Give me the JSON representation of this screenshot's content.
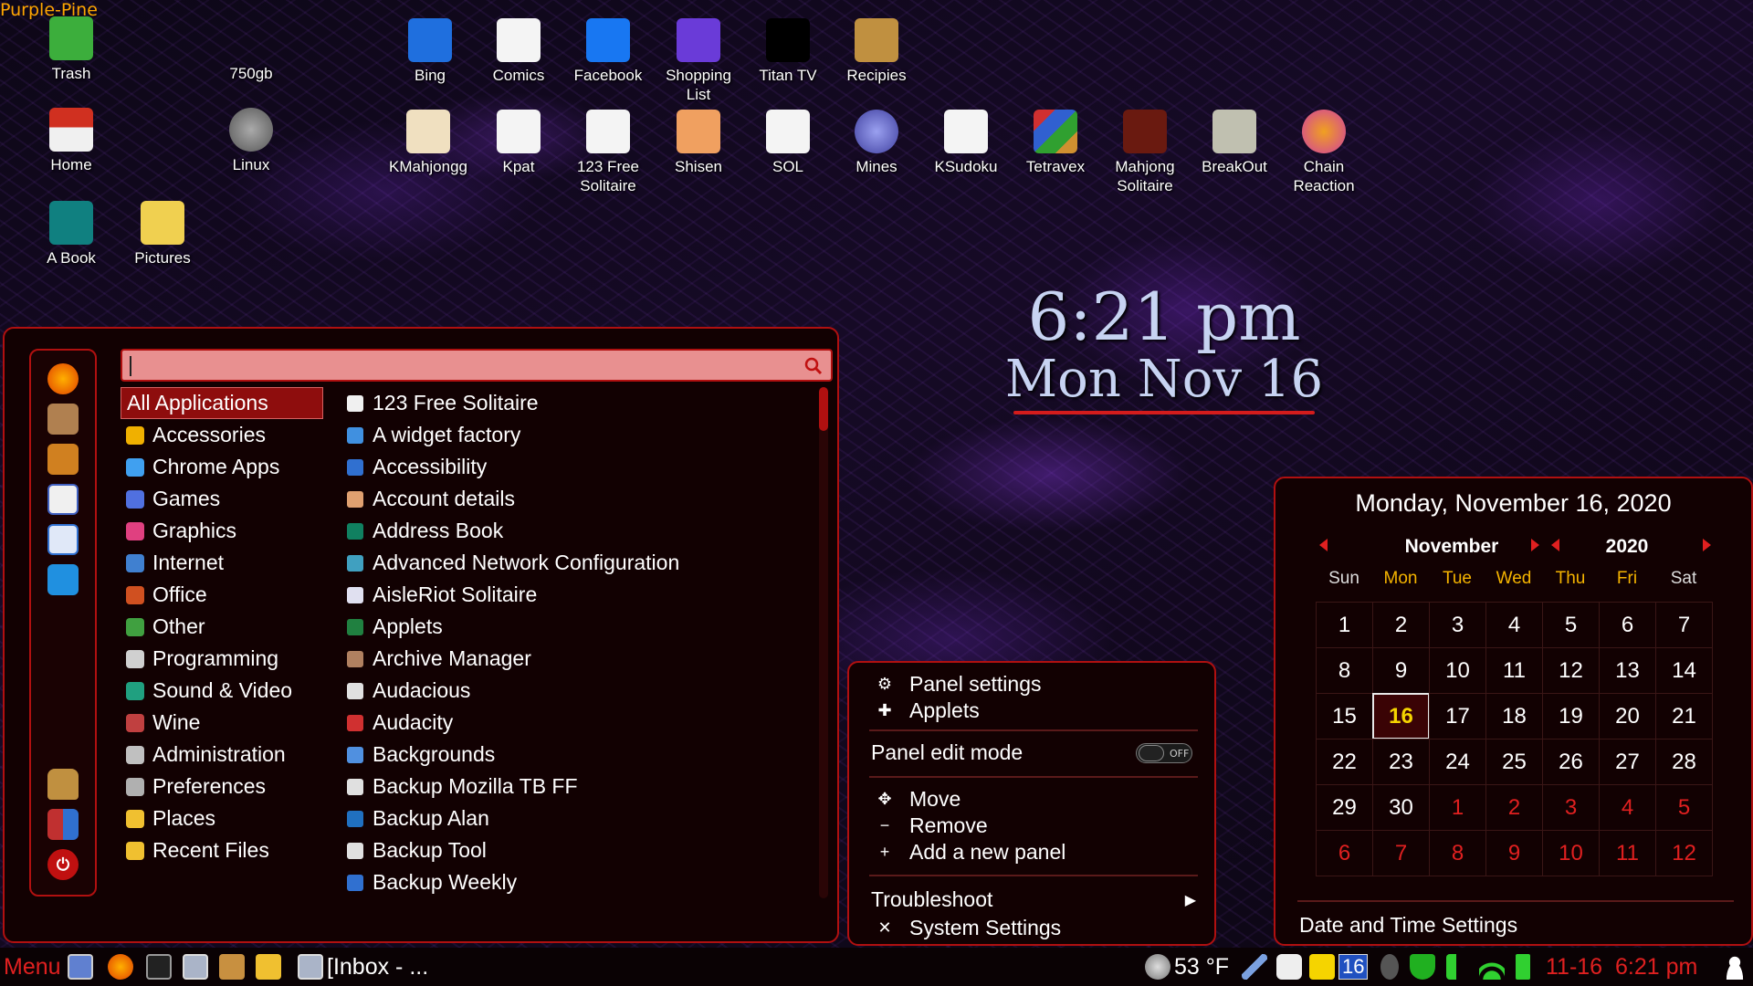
{
  "theme_label": "Purple-Pine",
  "desktop_icons": [
    {
      "label": "Trash",
      "icon": "trash-icon"
    },
    {
      "label": "750gb",
      "icon": "drive-r-icon"
    },
    {
      "label": "Home",
      "icon": "home-icon"
    },
    {
      "label": "Linux",
      "icon": "harddisk-icon"
    },
    {
      "label": "A Book",
      "icon": "address-book-icon"
    },
    {
      "label": "Pictures",
      "icon": "pictures-icon"
    },
    {
      "label": "Bing",
      "icon": "bing-icon"
    },
    {
      "label": "Comics",
      "icon": "newspaper-icon"
    },
    {
      "label": "Facebook",
      "icon": "facebook-icon"
    },
    {
      "label": "Shopping\nList",
      "icon": "shopping-cart-icon"
    },
    {
      "label": "Titan TV",
      "icon": "tv-icon"
    },
    {
      "label": "Recipies",
      "icon": "recipes-icon"
    },
    {
      "label": "KMahjongg",
      "icon": "mahjongg-icon"
    },
    {
      "label": "Kpat",
      "icon": "cards-icon"
    },
    {
      "label": "123 Free\nSolitaire",
      "icon": "solitaire-icon"
    },
    {
      "label": "Shisen",
      "icon": "shisen-icon"
    },
    {
      "label": "SOL",
      "icon": "sol-icon"
    },
    {
      "label": "Mines",
      "icon": "mines-icon"
    },
    {
      "label": "KSudoku",
      "icon": "sudoku-icon"
    },
    {
      "label": "Tetravex",
      "icon": "tetravex-icon"
    },
    {
      "label": "Mahjong\nSolitaire",
      "icon": "mahjong-solitaire-icon"
    },
    {
      "label": "BreakOut",
      "icon": "breakout-icon"
    },
    {
      "label": "Chain\nReaction",
      "icon": "chain-reaction-icon"
    }
  ],
  "clock": {
    "time": "6:21 pm",
    "date": "Mon Nov 16"
  },
  "menu": {
    "search": {
      "placeholder": ""
    },
    "categories": [
      {
        "label": "All Applications",
        "selected": true
      },
      {
        "label": "Accessories"
      },
      {
        "label": "Chrome Apps"
      },
      {
        "label": "Games"
      },
      {
        "label": "Graphics"
      },
      {
        "label": "Internet"
      },
      {
        "label": "Office"
      },
      {
        "label": "Other"
      },
      {
        "label": "Programming"
      },
      {
        "label": "Sound & Video"
      },
      {
        "label": "Wine"
      },
      {
        "label": "Administration"
      },
      {
        "label": "Preferences"
      },
      {
        "label": "Places"
      },
      {
        "label": "Recent Files"
      }
    ],
    "apps": [
      "123 Free Solitaire",
      "A widget factory",
      "Accessibility",
      "Account details",
      "Address Book",
      "Advanced Network Configuration",
      "AisleRiot Solitaire",
      "Applets",
      "Archive Manager",
      "Audacious",
      "Audacity",
      "Backgrounds",
      "Backup Mozilla TB FF",
      "Backup Alan",
      "Backup Tool",
      "Backup Weekly"
    ],
    "favorites": [
      "firefox-icon",
      "package-icon",
      "package-install-icon",
      "text-editor-icon",
      "document-viewer-icon",
      "system-monitor-icon",
      "lock-icon",
      "logout-icon",
      "power-icon"
    ]
  },
  "context_menu": {
    "panel_settings": "Panel settings",
    "applets": "Applets",
    "panel_edit_mode": "Panel edit mode",
    "toggle_state": "OFF",
    "move": "Move",
    "remove": "Remove",
    "add_panel": "Add a new panel",
    "troubleshoot": "Troubleshoot",
    "system_settings": "System Settings"
  },
  "calendar": {
    "header": "Monday, November 16, 2020",
    "month": "November",
    "year": "2020",
    "weekdays": [
      "Sun",
      "Mon",
      "Tue",
      "Wed",
      "Thu",
      "Fri",
      "Sat"
    ],
    "weeks": [
      [
        "1",
        "2",
        "3",
        "4",
        "5",
        "6",
        "7"
      ],
      [
        "8",
        "9",
        "10",
        "11",
        "12",
        "13",
        "14"
      ],
      [
        "15",
        "16",
        "17",
        "18",
        "19",
        "20",
        "21"
      ],
      [
        "22",
        "23",
        "24",
        "25",
        "26",
        "27",
        "28"
      ],
      [
        "29",
        "30",
        "1",
        "2",
        "3",
        "4",
        "5"
      ],
      [
        "6",
        "7",
        "8",
        "9",
        "10",
        "11",
        "12"
      ]
    ],
    "today": "16",
    "settings_label": "Date and Time Settings",
    "colors": {
      "accent": "#e02020",
      "today": "#f5d400",
      "weekday_highlight": "#f5b400"
    }
  },
  "taskbar": {
    "menu_label": "Menu",
    "window_label": "[Inbox - ...",
    "weather": "53 °F",
    "notif_count": "16",
    "datetime": "11-16  6:21 pm"
  }
}
